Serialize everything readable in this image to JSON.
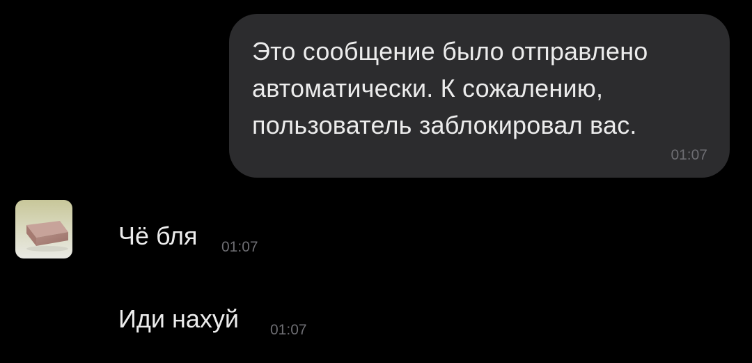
{
  "outgoing": {
    "lines": [
      "Это сообщение было отправлено",
      "автоматически. К сожалению,",
      "пользователь заблокировал вас."
    ],
    "time": "01:07"
  },
  "incoming": [
    {
      "text": "Чё бля",
      "time": "01:07"
    },
    {
      "text": "Иди нахуй",
      "time": "01:07"
    }
  ],
  "colors": {
    "background": "#000000",
    "bubble": "#2c2c2e",
    "text": "#ececec",
    "time": "#6e6e73"
  }
}
